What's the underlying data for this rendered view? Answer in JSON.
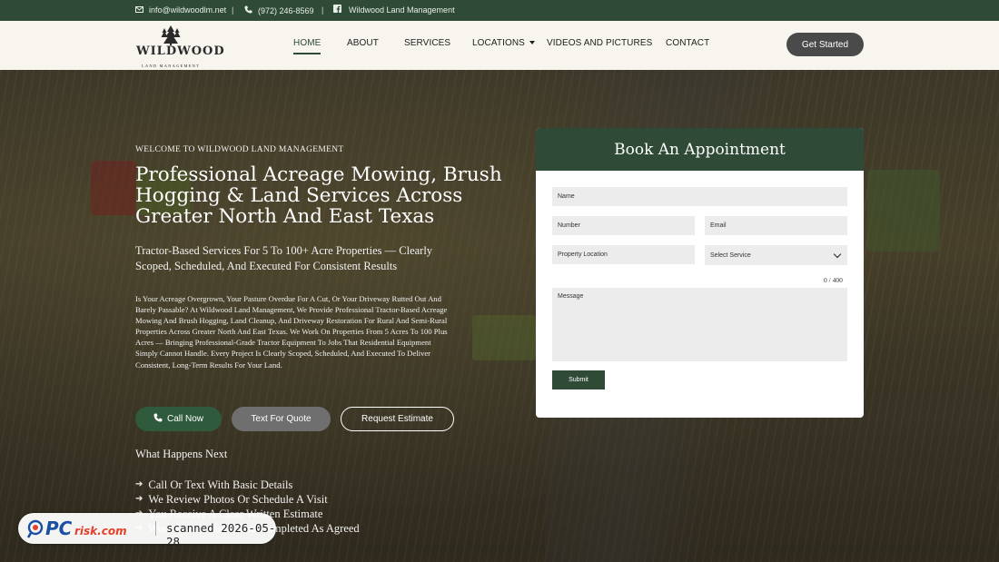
{
  "topbar": {
    "email": "info@wildwoodlm.net",
    "phone": "(972) 246-8569",
    "facebook": "Wildwood Land Management",
    "separator": "|"
  },
  "logo": {
    "name": "WILDWOOD",
    "tagline": "LAND MANAGEMENT"
  },
  "nav": {
    "items": [
      {
        "label": "HOME",
        "active": true
      },
      {
        "label": "ABOUT"
      },
      {
        "label": "SERVICES"
      },
      {
        "label": "LOCATIONS",
        "dropdown": true
      },
      {
        "label": "VIDEOS AND PICTURES"
      },
      {
        "label": "CONTACT"
      }
    ],
    "cta": "Get Started"
  },
  "hero": {
    "welcome": "WELCOME TO WILDWOOD LAND MANAGEMENT",
    "title": "Professional Acreage Mowing, Brush Hogging & Land Services Across Greater North And East Texas",
    "subtitle": "Tractor-Based Services For 5 To 100+ Acre Properties — Clearly Scoped, Scheduled, And Executed For Consistent Results",
    "body": "Is Your Acreage Overgrown, Your Pasture Overdue For A Cut, Or Your Driveway Rutted Out And Barely Passable? At Wildwood Land Management, We Provide Professional Tractor-Based Acreage Mowing And Brush Hogging, Land Cleanup, And Driveway Restoration For Rural And Semi-Rural Properties Across Greater North And East Texas. We Work On Properties From 5 Acres To 100 Plus Acres — Bringing Professional-Grade Tractor Equipment To Jobs That Residential Equipment Simply Cannot Handle. Every Project Is Clearly Scoped, Scheduled, And Executed To Deliver Consistent, Long-Term Results For Your Land.",
    "buttons": {
      "call": "Call Now",
      "text": "Text For Quote",
      "estimate": "Request Estimate"
    },
    "next_title": "What Happens Next",
    "steps": [
      "Call Or Text With Basic Details",
      "We Review Photos Or Schedule A Visit",
      "You Receive A Clear Written Estimate",
      "Work Is Scheduled And Completed As Agreed"
    ]
  },
  "form": {
    "title": "Book An Appointment",
    "name_placeholder": "Name",
    "number_placeholder": "Number",
    "email_placeholder": "Email",
    "location_placeholder": "Property Location",
    "service_select": "Select Service",
    "counter": "0 / 400",
    "message_placeholder": "Message",
    "submit": "Submit"
  },
  "watermark": {
    "brand": "PCrisk.com",
    "scan": "scanned 2026-05-28"
  },
  "colors": {
    "brand_green": "#2f4a36",
    "nav_bg": "#f7f5ee",
    "cta_gray": "#4a4a4a"
  }
}
